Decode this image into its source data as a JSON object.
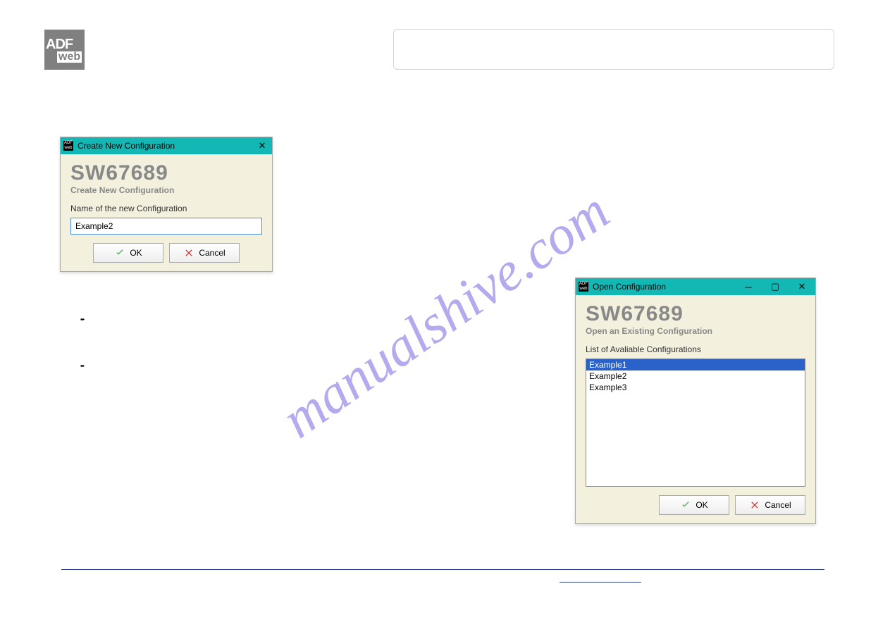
{
  "watermark": "manualshive.com",
  "logo": {
    "line1": "ADF",
    "line2": "web"
  },
  "dlg_create": {
    "title": "Create New Configuration",
    "heading": "SW67689",
    "subheading": "Create New Configuration",
    "field_label": "Name of the new Configuration",
    "field_value": "Example2",
    "ok": "OK",
    "cancel": "Cancel"
  },
  "dlg_open": {
    "title": "Open Configuration",
    "heading": "SW67689",
    "subheading": "Open an Existing Configuration",
    "list_label": "List of Avaliable Configurations",
    "items": [
      "Example1",
      "Example2",
      "Example3"
    ],
    "selected": "Example1",
    "ok": "OK",
    "cancel": "Cancel"
  }
}
